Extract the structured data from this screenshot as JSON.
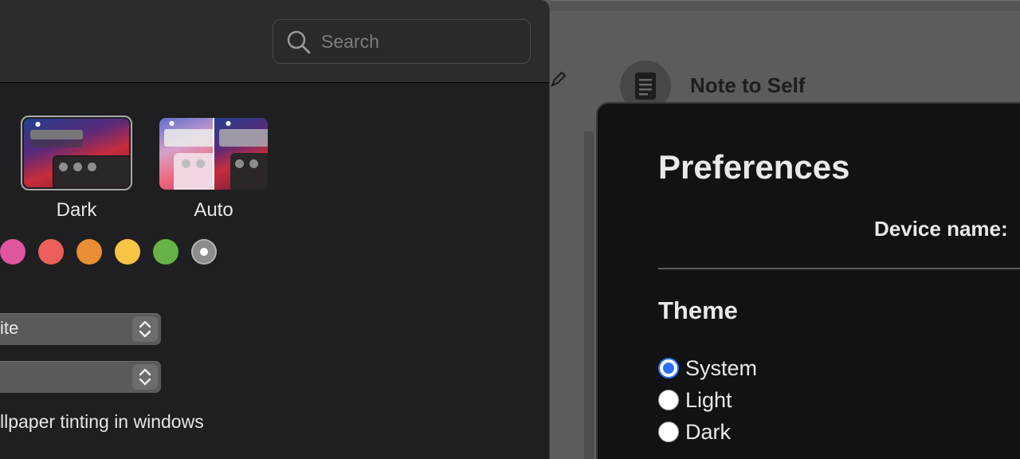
{
  "background_app": {
    "conversation_title": "Note to Self"
  },
  "system_preferences": {
    "search": {
      "placeholder": "Search",
      "value": ""
    },
    "appearance_options": [
      {
        "label": "Dark",
        "selected": true
      },
      {
        "label": "Auto",
        "selected": false
      }
    ],
    "accent_colors": [
      {
        "name": "pink",
        "color": "#e0569e",
        "selected": false
      },
      {
        "name": "red",
        "color": "#ec5f5b",
        "selected": false
      },
      {
        "name": "orange",
        "color": "#e98e35",
        "selected": false
      },
      {
        "name": "yellow",
        "color": "#f6c544",
        "selected": false
      },
      {
        "name": "green",
        "color": "#66b247",
        "selected": false
      },
      {
        "name": "graphite",
        "color": "#8c8c8c",
        "selected": true
      }
    ],
    "highlight_popup_value": "ite",
    "sidebar_icon_popup_value": "",
    "wallpaper_tinting_label": "llpaper tinting in windows"
  },
  "preferences": {
    "title": "Preferences",
    "device_name_label": "Device name:",
    "theme_heading": "Theme",
    "theme_options": [
      {
        "label": "System",
        "checked": true
      },
      {
        "label": "Light",
        "checked": false
      },
      {
        "label": "Dark",
        "checked": false
      }
    ]
  },
  "colors": {
    "accent_blue": "#2a6ef5",
    "window_bg": "#1f1f21",
    "prefs_bg": "#121212"
  }
}
